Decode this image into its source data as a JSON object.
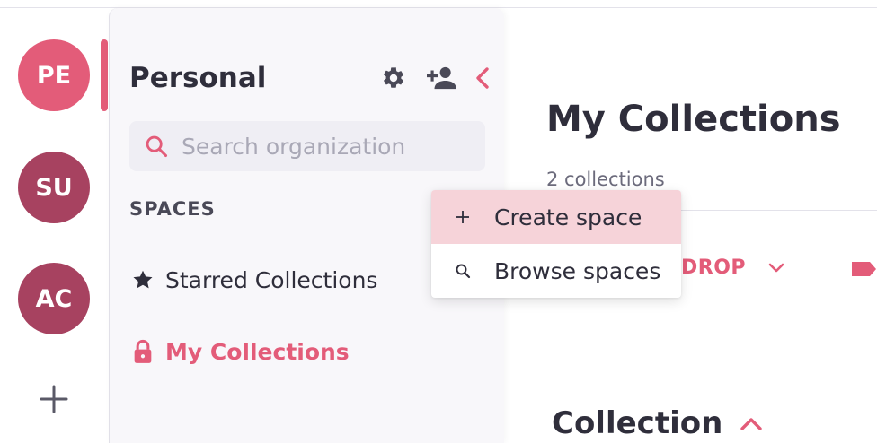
{
  "rail": {
    "orgs": [
      {
        "initials": "PE",
        "color": "#e35c79",
        "active": true
      },
      {
        "initials": "SU",
        "color": "#a74260",
        "active": false
      },
      {
        "initials": "AC",
        "color": "#a74260",
        "active": false
      }
    ],
    "add_icon": "plus-icon"
  },
  "sidebar": {
    "org_name": "Personal",
    "icons": [
      "gear-icon",
      "person-add-icon",
      "chevron-left-icon"
    ],
    "search": {
      "placeholder": "Search organization",
      "value": ""
    },
    "spaces_heading": "SPACES",
    "items": [
      {
        "label": "Starred Collections",
        "icon": "star-icon",
        "active": false
      },
      {
        "label": "My Collections",
        "icon": "lock-icon",
        "active": true
      }
    ]
  },
  "main": {
    "title": "My Collections",
    "count": "2 collections",
    "drop_label": "DROP",
    "collection_heading": "Collection"
  },
  "menu": {
    "items": [
      {
        "label": "Create space",
        "icon": "plus-icon",
        "highlighted": true
      },
      {
        "label": "Browse spaces",
        "icon": "search-icon",
        "highlighted": false
      }
    ]
  },
  "colors": {
    "accent": "#e35c79",
    "accent_dark": "#a74260",
    "text": "#2f2e3b",
    "highlight": "#f6d3d9",
    "sidebar_bg": "#f8f7fa"
  }
}
